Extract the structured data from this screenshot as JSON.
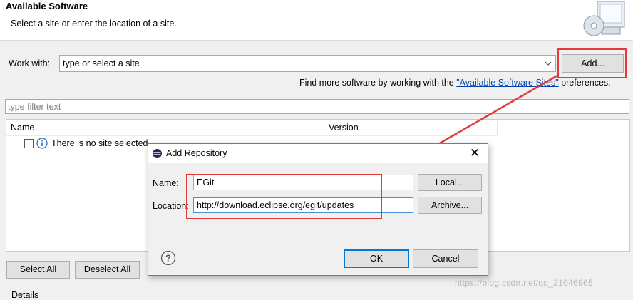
{
  "header": {
    "title": "Available Software",
    "subtitle": "Select a site or enter the location of a site."
  },
  "workwith": {
    "label": "Work with:",
    "value": "type or select a site",
    "add_button": "Add..."
  },
  "findmore": {
    "prefix": "Find more software by working with the ",
    "link": "\"Available Software Sites\"",
    "suffix": " preferences."
  },
  "filter": {
    "placeholder": "type filter text"
  },
  "table": {
    "columns": [
      "Name",
      "Version"
    ],
    "empty_row": "There is no site selected."
  },
  "buttons": {
    "select_all": "Select All",
    "deselect_all": "Deselect All"
  },
  "details_label": "Details",
  "dialog": {
    "title": "Add Repository",
    "name_label": "Name:",
    "name_value": "EGit",
    "location_label": "Location:",
    "location_value": "http://download.eclipse.org/egit/updates",
    "local_button": "Local...",
    "archive_button": "Archive...",
    "ok_button": "OK",
    "cancel_button": "Cancel"
  },
  "watermark": "https://blog.csdn.net/qq_21046965",
  "colors": {
    "highlight": "#e33a3a",
    "link": "#0645ad",
    "focus": "#0078d7"
  }
}
